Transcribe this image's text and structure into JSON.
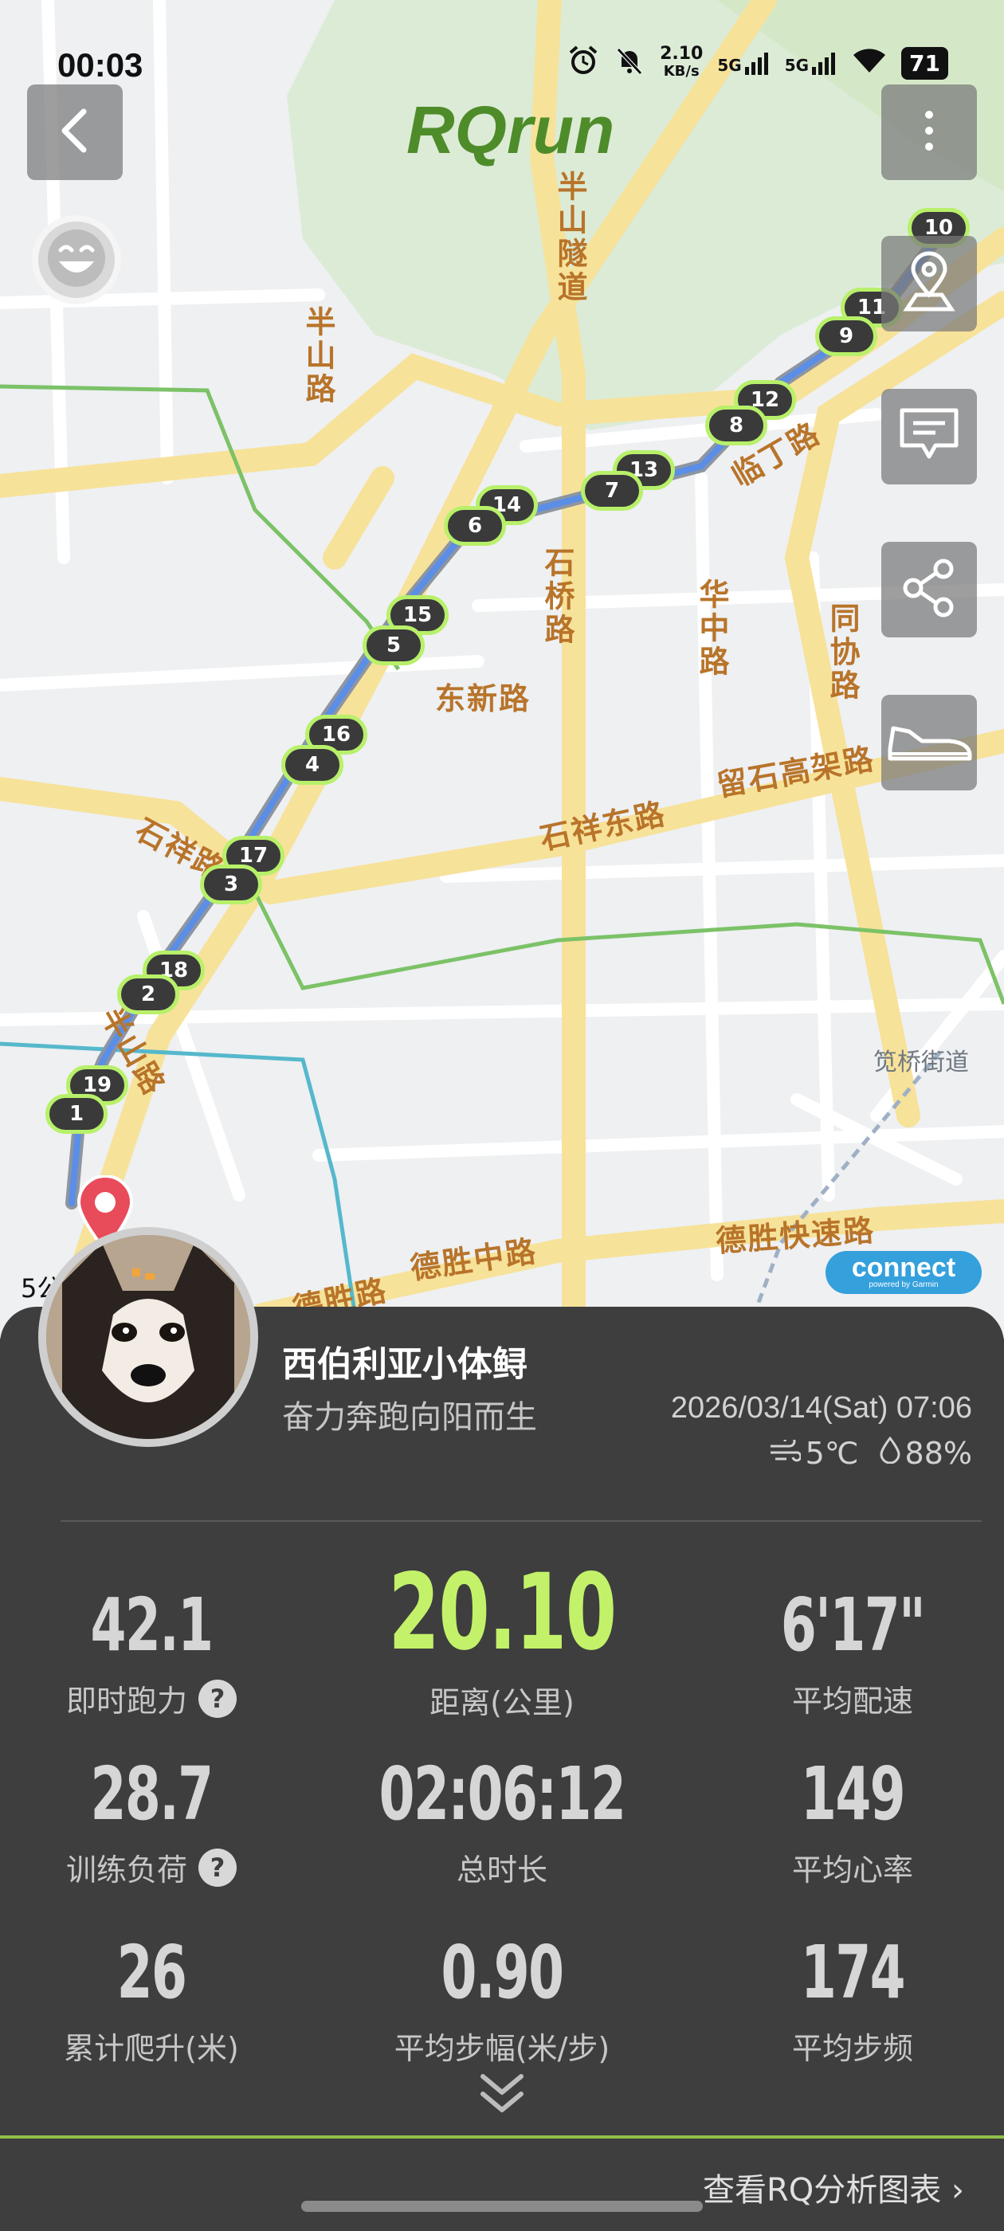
{
  "status_bar": {
    "time": "00:03",
    "net_speed_top": "2.10",
    "net_speed_unit": "KB/s",
    "signal1": "5G",
    "signal2": "5G",
    "battery": "71"
  },
  "app": {
    "title": "RQrun"
  },
  "map": {
    "road_labels": [
      "半山隧道",
      "半山路",
      "临丁路",
      "石桥路",
      "华中路",
      "同协路",
      "东新路",
      "留石高架路",
      "石祥东路",
      "石祥路",
      "半山路",
      "德胜快速路",
      "德胜中路",
      "德胜路"
    ],
    "place_label": "笕桥街道",
    "km_markers": [
      "10",
      "11",
      "9",
      "12",
      "8",
      "13",
      "7",
      "14",
      "6",
      "15",
      "5",
      "16",
      "4",
      "17",
      "3",
      "18",
      "2",
      "19",
      "1"
    ],
    "scale_text": "5公",
    "badge_big": "connect",
    "badge_small": "powered by Garmin",
    "route_color": "#5b8ee6",
    "marker_ring_color": "#b8f06a"
  },
  "controls": {
    "back_icon": "chevron-left-icon",
    "more_icon": "more-vertical-icon",
    "location_icon": "map-pin-icon",
    "comment_icon": "comment-icon",
    "share_icon": "share-icon",
    "shoe_icon": "shoe-icon",
    "mood_icon": "smiley-icon"
  },
  "profile": {
    "name": "西伯利亚小体鲟",
    "motto": "奋力奔跑向阳而生",
    "datetime": "2026/03/14(Sat) 07:06",
    "temperature": "5℃",
    "humidity": "88%"
  },
  "stats": [
    {
      "value": "42.1",
      "label": "即时跑力",
      "help": "?"
    },
    {
      "value": "20.10",
      "label": "距离(公里)"
    },
    {
      "value": "6'17\"",
      "label": "平均配速"
    },
    {
      "value": "28.7",
      "label": "训练负荷",
      "help": "?"
    },
    {
      "value": "02:06:12",
      "label": "总时长"
    },
    {
      "value": "149",
      "label": "平均心率"
    },
    {
      "value": "26",
      "label": "累计爬升(米)"
    },
    {
      "value": "0.90",
      "label": "平均步幅(米/步)"
    },
    {
      "value": "174",
      "label": "平均步频"
    }
  ],
  "footer": {
    "report_link": "查看RQ分析图表 ›",
    "accent": "#c3f26a"
  }
}
